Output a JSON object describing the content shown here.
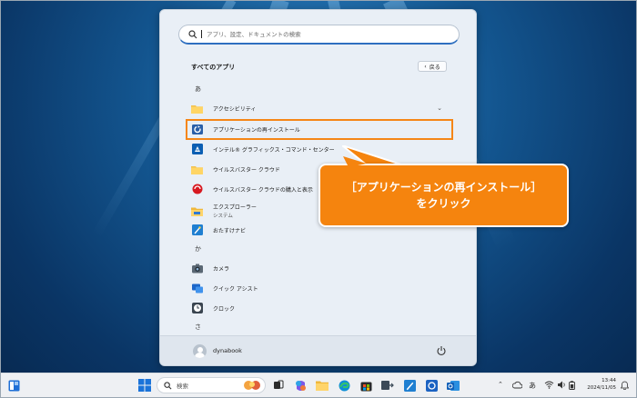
{
  "search": {
    "placeholder": "アプリ、設定、ドキュメントの検索"
  },
  "start_menu": {
    "title": "すべてのアプリ",
    "back_label": "戻る",
    "sections": [
      {
        "letter": "あ",
        "items": [
          {
            "name": "アクセシビリティ",
            "icon": "folder-icon",
            "expandable": true
          },
          {
            "name": "アプリケーションの再インストール",
            "icon": "reinstall-app-icon"
          },
          {
            "name": "インテル® グラフィックス・コマンド・センター",
            "icon": "intel-graphics-icon"
          },
          {
            "name": "ウイルスバスター クラウド",
            "icon": "folder-icon"
          },
          {
            "name": "ウイルスバスター クラウドの購入と表示",
            "icon": "virusbuster-icon"
          },
          {
            "name": "エクスプローラー",
            "subtitle": "システム",
            "icon": "file-explorer-icon"
          },
          {
            "name": "おたすけナビ",
            "icon": "otasuke-navi-icon"
          }
        ]
      },
      {
        "letter": "か",
        "items": [
          {
            "name": "カメラ",
            "icon": "camera-icon"
          },
          {
            "name": "クイック アシスト",
            "icon": "quick-assist-icon"
          },
          {
            "name": "クロック",
            "icon": "clock-icon"
          }
        ]
      },
      {
        "letter": "さ",
        "items": []
      }
    ],
    "user_name": "dynabook"
  },
  "callout": {
    "line1": "［アプリケーションの再インストール］",
    "line2": "をクリック"
  },
  "taskbar": {
    "search_label": "検索",
    "ime_label": "あ",
    "time": "13:44",
    "date": "2024/11/05"
  },
  "colors": {
    "accent_orange": "#f58617",
    "highlight_border": "#f58617"
  }
}
